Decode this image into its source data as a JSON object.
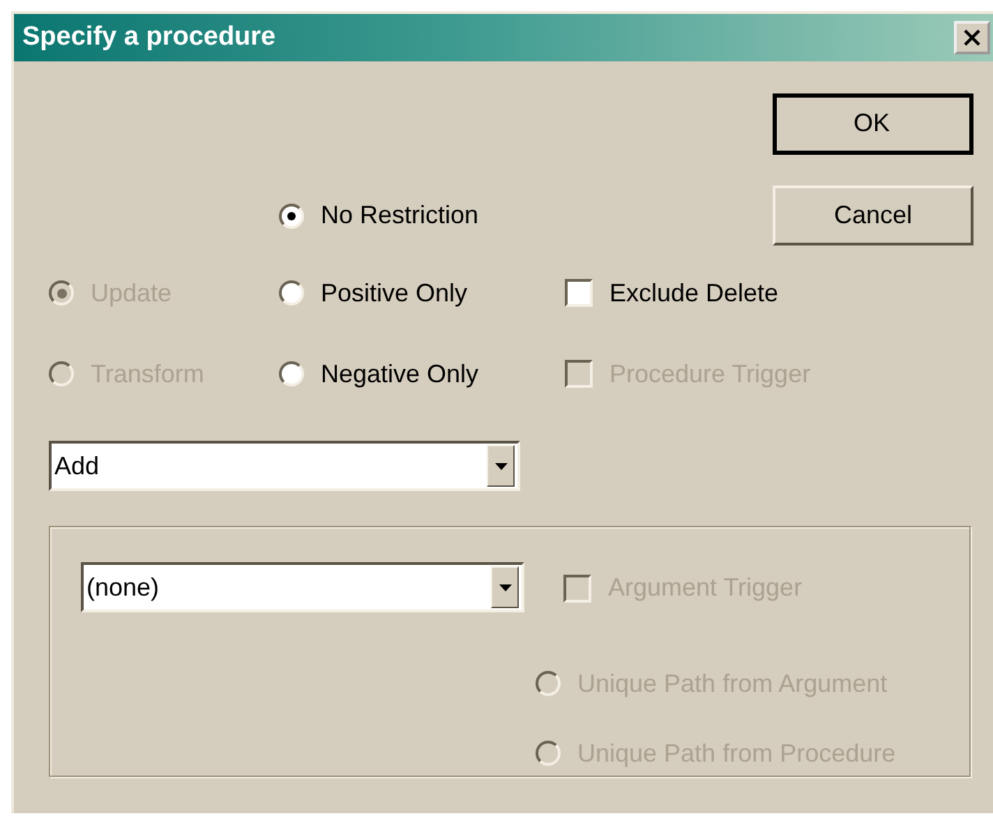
{
  "window": {
    "title": "Specify a procedure"
  },
  "buttons": [
    {
      "label": "OK",
      "default": true
    },
    {
      "label": "Cancel",
      "default": false
    }
  ],
  "mode_options": [
    {
      "label": "Update",
      "selected": true,
      "disabled": true
    },
    {
      "label": "Transform",
      "selected": false,
      "disabled": true
    }
  ],
  "restriction_options": [
    {
      "label": "No Restriction",
      "selected": true,
      "disabled": false
    },
    {
      "label": "Positive Only",
      "selected": false,
      "disabled": false
    },
    {
      "label": "Negative Only",
      "selected": false,
      "disabled": false
    }
  ],
  "checkboxes": [
    {
      "label": "Exclude Delete",
      "checked": false,
      "disabled": false
    },
    {
      "label": "Procedure Trigger",
      "checked": false,
      "disabled": true
    }
  ],
  "operation_dropdown": {
    "value": "Add"
  },
  "group": {
    "dropdown": {
      "value": "(none)"
    },
    "argument_trigger": {
      "label": "Argument Trigger",
      "checked": false,
      "disabled": true
    },
    "path_options": [
      {
        "label": "Unique Path from Argument",
        "selected": false,
        "disabled": true
      },
      {
        "label": "Unique Path from Procedure",
        "selected": false,
        "disabled": true
      }
    ]
  }
}
